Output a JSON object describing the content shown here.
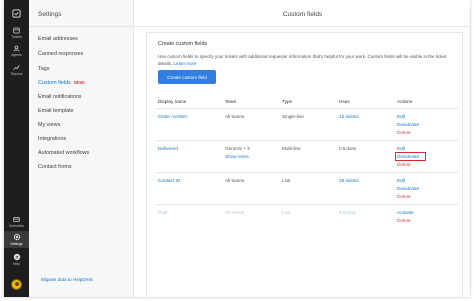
{
  "rail": {
    "items": [
      {
        "icon": "tickets-icon",
        "label": "Tickets"
      },
      {
        "icon": "agents-icon",
        "label": "Agents"
      },
      {
        "icon": "reports-icon",
        "label": "Reports"
      },
      {
        "icon": "subscription-icon",
        "label": "Subscribe"
      },
      {
        "icon": "settings-icon",
        "label": "Settings"
      },
      {
        "icon": "help-icon",
        "label": "Help"
      }
    ]
  },
  "sidebar": {
    "title": "Settings",
    "items": [
      {
        "label": "Email addresses"
      },
      {
        "label": "Canned responses"
      },
      {
        "label": "Tags"
      },
      {
        "label": "Custom fields",
        "badge": "NEW!"
      },
      {
        "label": "Email notifications"
      },
      {
        "label": "Email template"
      },
      {
        "label": "My views"
      },
      {
        "label": "Integrations"
      },
      {
        "label": "Automated workflows"
      },
      {
        "label": "Contact forms"
      }
    ],
    "migrate": "Migrate data to HelpDesk"
  },
  "main": {
    "title": "Custom fields",
    "section_title": "Create custom fields",
    "description": "Use custom fields to specify your tickets with additional requester information that's helpful for your work. Custom fields will be visible in the ticket details.",
    "learn_more": "Learn more",
    "create_button": "Create custom field",
    "columns": [
      "Display name",
      "Team",
      "Type",
      "Uses",
      "Actions"
    ],
    "rows": [
      {
        "name": "Order number",
        "team": "All teams",
        "type": "Single-line",
        "uses": "12 tickets",
        "actions": [
          "Edit",
          "Deactivate",
          "Delete"
        ],
        "state": "active"
      },
      {
        "name": "Delivered",
        "team": "General + 3",
        "team_more": "Show more",
        "type": "Multi-line",
        "uses": "0 tickets",
        "actions": [
          "Edit",
          "Deactivate",
          "Delete"
        ],
        "state": "active"
      },
      {
        "name": "Contact ID",
        "team": "All teams",
        "type": "Link",
        "uses": "35 tickets",
        "actions": [
          "Edit",
          "Deactivate",
          "Delete"
        ],
        "state": "active"
      },
      {
        "name": "Paid",
        "team": "All teams",
        "type": "Link",
        "uses": "8 tickets",
        "actions": [
          "Activate",
          "Delete"
        ],
        "state": "inactive"
      }
    ]
  },
  "colors": {
    "accent": "#2f7ee0",
    "danger": "#e0413b",
    "rail": "#1e1e1e",
    "highlight": "#d62d2d"
  }
}
